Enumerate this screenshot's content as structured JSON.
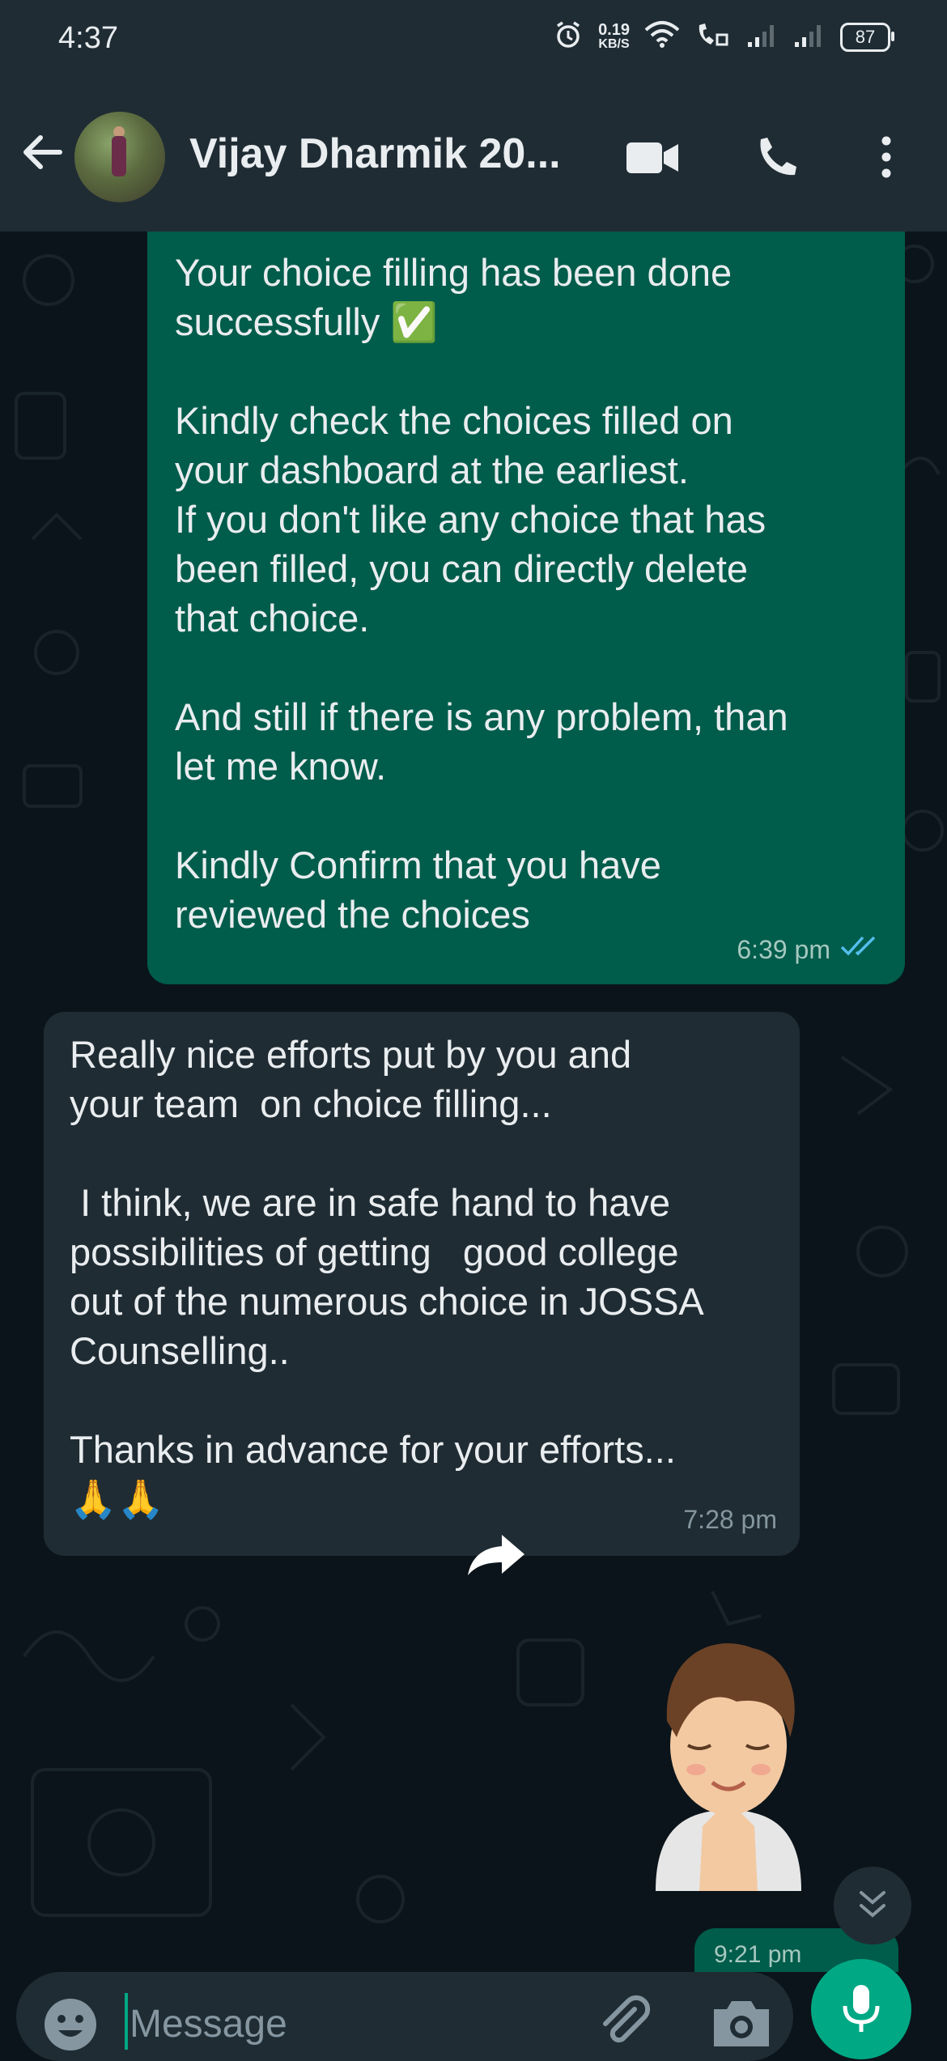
{
  "status_bar": {
    "time": "4:37",
    "net_speed_value": "0.19",
    "net_speed_unit": "KB/S",
    "battery": "87"
  },
  "header": {
    "contact_name": "Vijay Dharmik 20..."
  },
  "messages": {
    "outgoing_1": {
      "text": "Your choice filling has been done\nsuccessfully ✅\n\nKindly check the choices filled on\nyour dashboard at the earliest.\nIf you don't like any choice that has\nbeen filled, you can directly delete\nthat choice.\n\nAnd still if there is any problem, than\nlet me know.\n\nKindly Confirm that you have\nreviewed the choices",
      "time": "6:39 pm"
    },
    "incoming_1": {
      "text": "Really nice efforts put by you and\nyour team  on choice filling...\n\n I think, we are in safe hand to have\npossibilities of getting   good college\nout of the numerous choice in JOSSA\nCounselling..\n\nThanks in advance for your efforts...\n🙏🙏",
      "time": "7:28 pm"
    },
    "outgoing_2_peek": {
      "time": "9:21 pm"
    }
  },
  "composer": {
    "placeholder": "Message"
  },
  "colors": {
    "outgoing_bubble": "#005c4b",
    "incoming_bubble": "#202c33",
    "accent": "#00a884",
    "read_ticks": "#53bdeb",
    "background": "#0b141a",
    "header": "#1f2c34"
  }
}
